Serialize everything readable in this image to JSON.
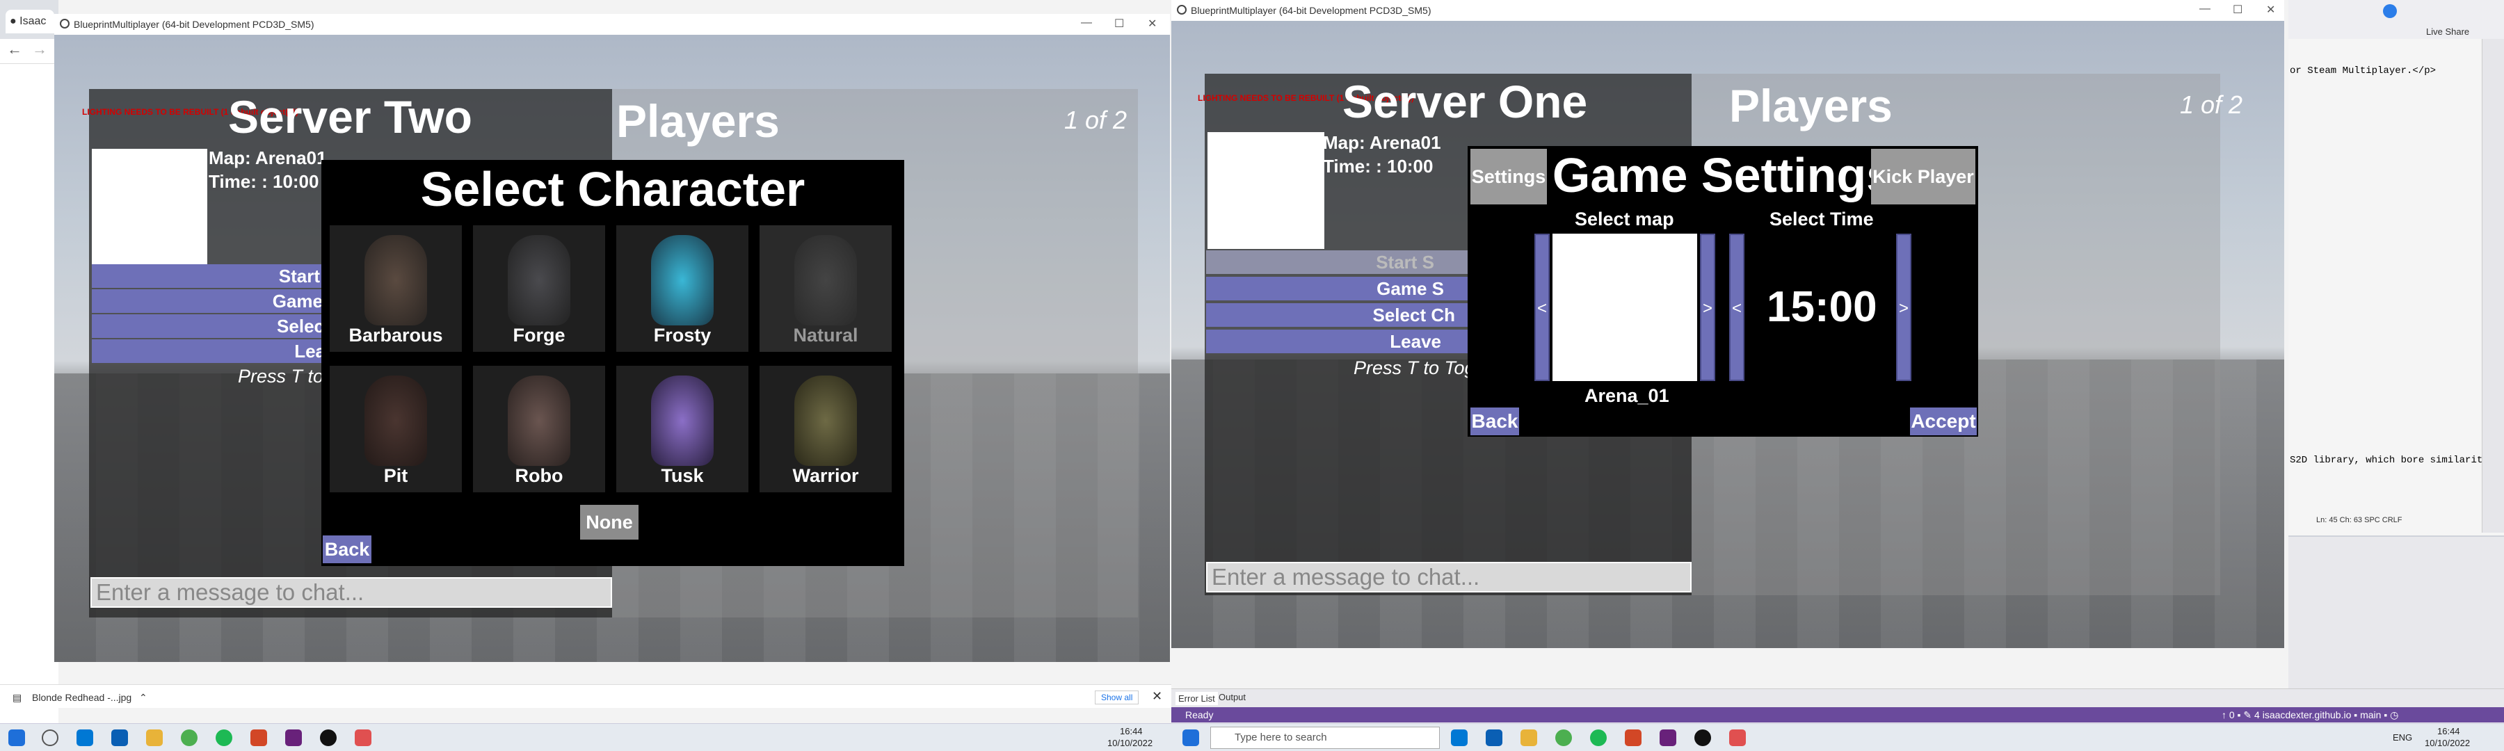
{
  "browser": {
    "tab_title": "Isaac",
    "back_icon": "arrow-left-icon",
    "forward_icon": "arrow-right-icon"
  },
  "downloads_bar": {
    "file": "Blonde Redhead -...jpg",
    "show_all": "Show all"
  },
  "window_left": {
    "title": "BlueprintMultiplayer (64-bit Development PCD3D_SM5)",
    "server_name": "Server Two",
    "players_label": "Players",
    "page": "1 of 2",
    "warning": "LIGHTING NEEDS TO BE REBUILT (1 unbuilt object(s))",
    "map_text": "Map: Arena01",
    "time_text": "Time: : 10:00",
    "menu_buttons": [
      "Start",
      "Game",
      "Selec",
      "Lea"
    ],
    "hint": "Press T to",
    "chat_placeholder": "Enter a message to chat...",
    "select_character": {
      "title": "Select Character",
      "characters": [
        {
          "name": "Barbarous",
          "available": true
        },
        {
          "name": "Forge",
          "available": true
        },
        {
          "name": "Frosty",
          "available": true
        },
        {
          "name": "Natural",
          "available": false
        },
        {
          "name": "Pit",
          "available": true
        },
        {
          "name": "Robo",
          "available": true
        },
        {
          "name": "Tusk",
          "available": true
        },
        {
          "name": "Warrior",
          "available": true
        }
      ],
      "none_label": "None",
      "back_label": "Back"
    }
  },
  "window_right": {
    "title": "BlueprintMultiplayer (64-bit Development PCD3D_SM5)",
    "server_name": "Server One",
    "players_label": "Players",
    "page": "1 of 2",
    "warning": "LIGHTING NEEDS TO BE REBUILT (1 unbuilt object(s))",
    "map_text": "Map: Arena01",
    "time_text": "Time: : 10:00",
    "menu_buttons": [
      "Start S",
      "Game S",
      "Select Ch",
      "Leave"
    ],
    "hint": "Press T to Tog",
    "chat_placeholder": "Enter a message to chat...",
    "game_settings": {
      "title": "Game Settings",
      "settings_tab": "Settings",
      "kick_tab": "Kick Player",
      "select_map_label": "Select map",
      "select_time_label": "Select Time",
      "map_name": "Arena_01",
      "time_value": "15:00",
      "arrow_left": "<",
      "arrow_right": ">",
      "back_label": "Back",
      "accept_label": "Accept"
    }
  },
  "visual_studio": {
    "code_line_1": "or Steam Multiplayer.</p>",
    "code_line_2": "S2D library, which bore similarit",
    "cursor_pos": "Ln: 45   Ch: 63   SPC   CRLF",
    "live_share": "Live Share",
    "tabs": [
      "Error List",
      "Output"
    ],
    "status_ready": "Ready",
    "status_right": "↑ 0 ▪   ✎ 4   isaacdexter.github.io ▪   main ▪   ◷"
  },
  "taskbar": {
    "search_placeholder": "Type here to search",
    "time_left": "16:44",
    "date_left": "10/10/2022",
    "time_right": "16:44",
    "date_right": "10/10/2022",
    "lang": "ENG"
  }
}
